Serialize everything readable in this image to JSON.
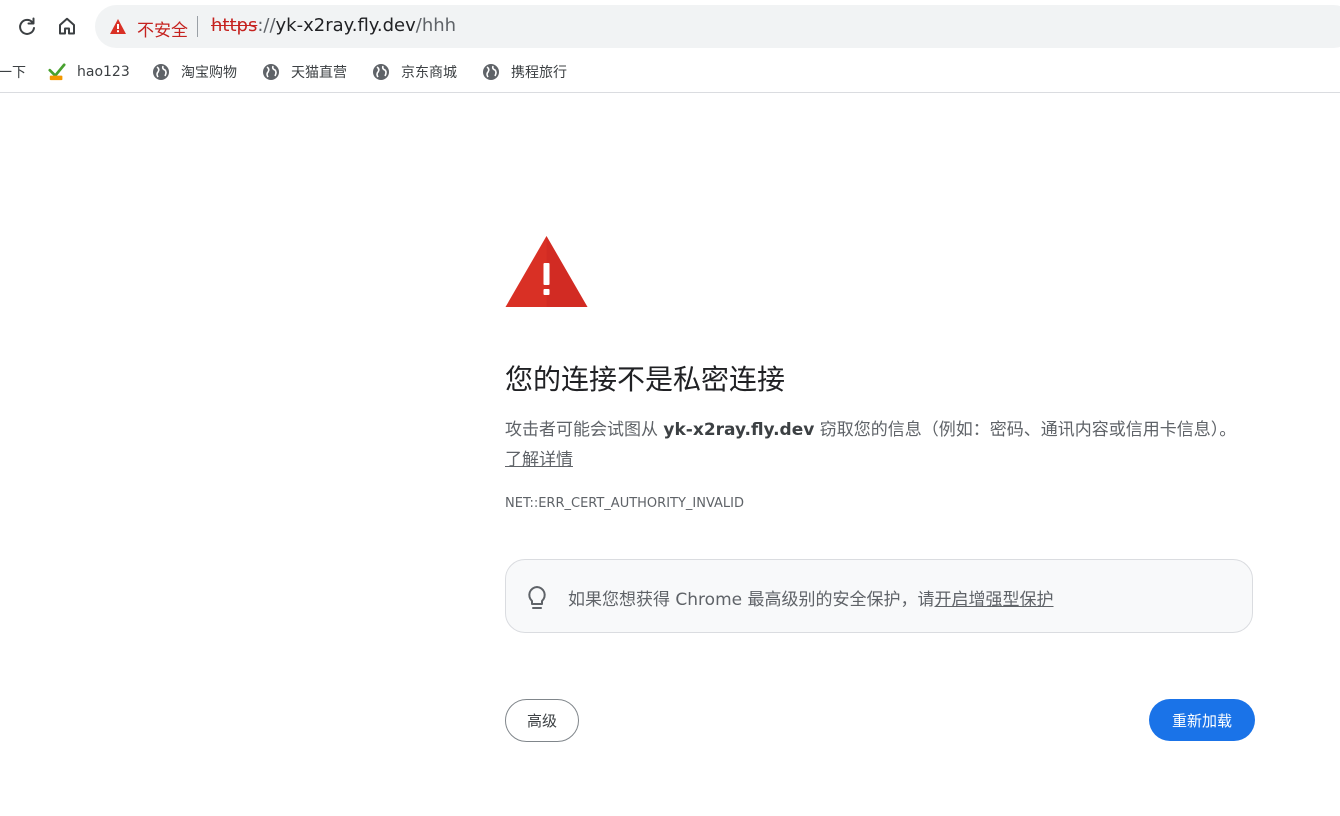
{
  "toolbar": {
    "reload_icon": "reload-icon",
    "home_icon": "home-icon",
    "omnibox": {
      "security_icon": "warning-triangle-icon",
      "security_label": "不安全",
      "url_scheme": "https",
      "url_sep": "://",
      "url_host": "yk-x2ray.fly.dev",
      "url_path": "/hhh"
    }
  },
  "bookmarks": [
    {
      "label": "一下",
      "icon": "none"
    },
    {
      "label": "hao123",
      "icon": "hao123-logo"
    },
    {
      "label": "淘宝购物",
      "icon": "globe-icon"
    },
    {
      "label": "天猫直营",
      "icon": "globe-icon"
    },
    {
      "label": "京东商城",
      "icon": "globe-icon"
    },
    {
      "label": "携程旅行",
      "icon": "globe-icon"
    }
  ],
  "interstitial": {
    "heading": "您的连接不是私密连接",
    "body_prefix": "攻击者可能会试图从 ",
    "body_host": "yk-x2ray.fly.dev",
    "body_suffix": " 窃取您的信息（例如：密码、通讯内容或信用卡信息）。",
    "learn_more": "了解详情",
    "error_code": "NET::ERR_CERT_AUTHORITY_INVALID",
    "tip_prefix": "如果您想获得 Chrome 最高级别的安全保护，请",
    "tip_link": "开启增强型保护",
    "advanced_button": "高级",
    "reload_button": "重新加载"
  },
  "colors": {
    "danger": "#d93025",
    "primary": "#1a73e8"
  }
}
